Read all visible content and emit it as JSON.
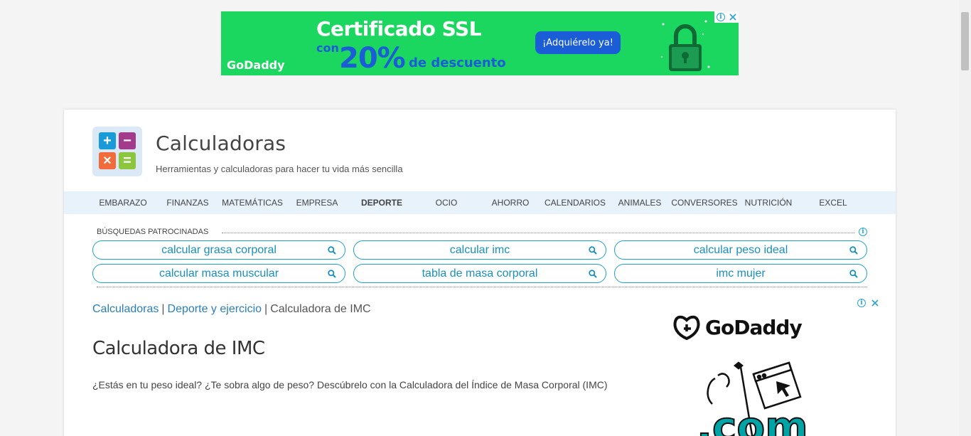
{
  "top_ad": {
    "headline": "Certificado SSL",
    "con": "con",
    "percent": "20%",
    "rest": "de descuento",
    "brand": "GoDaddy",
    "cta": "¡Adquiérelo ya!",
    "colors": {
      "background": "#1bd760",
      "accent": "#1a5dd6"
    }
  },
  "site": {
    "title": "Calculadoras",
    "subtitle": "Herramientas y calculadoras para hacer tu vida más sencilla"
  },
  "nav": {
    "items": [
      {
        "label": "EMBARAZO"
      },
      {
        "label": "FINANZAS"
      },
      {
        "label": "MATEMÁTICAS"
      },
      {
        "label": "EMPRESA"
      },
      {
        "label": "DEPORTE",
        "active": true
      },
      {
        "label": "OCIO"
      },
      {
        "label": "AHORRO"
      },
      {
        "label": "CALENDARIOS"
      },
      {
        "label": "ANIMALES"
      },
      {
        "label": "CONVERSORES"
      },
      {
        "label": "NUTRICIÓN"
      },
      {
        "label": "EXCEL"
      }
    ]
  },
  "sponsored": {
    "label": "BÚSQUEDAS PATROCINADAS",
    "searches": [
      "calcular grasa corporal",
      "calcular imc",
      "calcular peso ideal",
      "calcular masa muscular",
      "tabla de masa corporal",
      "imc mujer"
    ]
  },
  "breadcrumb": {
    "items": [
      "Calculadoras",
      "Deporte y ejercicio",
      "Calculadora de IMC"
    ],
    "separator": "|"
  },
  "main": {
    "title": "Calculadora de IMC",
    "intro": "¿Estás en tu peso ideal? ¿Te sobra algo de peso? Descúbrelo con la Calculadora del Índice de Masa Corporal (IMC)"
  },
  "side_ad": {
    "brand": "GoDaddy",
    "domain_text": ".com"
  },
  "colors": {
    "link": "#2a7fb8",
    "pill_border": "#1f9ec9",
    "nav_bg": "#e8f2fb"
  },
  "icons": {
    "logo": "calculator-logo-icon",
    "search": "magnifier-icon",
    "info": "info-icon",
    "close": "close-icon"
  }
}
